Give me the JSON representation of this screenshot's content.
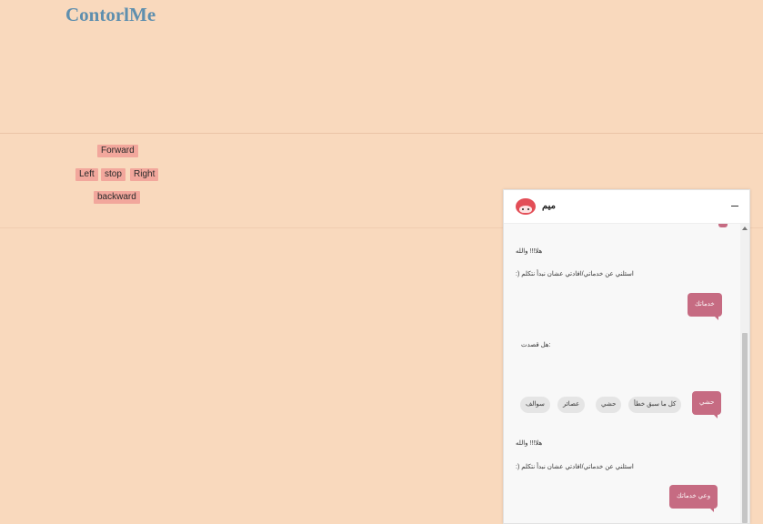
{
  "app": {
    "title": "ContorlMe"
  },
  "controls": {
    "forward": "Forward",
    "left": "Left",
    "stop": "stop",
    "right": "Right",
    "backward": "backward"
  },
  "chat": {
    "bot_name": "ميم",
    "messages": {
      "greeting_1": "هلا!!! والله",
      "intro_1": ":) اسئلني عن خدماتي/افادتي عشان نبدأ نتكلم",
      "user_1": "خدماتك",
      "question": "هل قصدت:",
      "user_2": "حشي",
      "greeting_2": "هلا!!! والله",
      "intro_2": ":) اسئلني عن خدماتي/افادتي عشان نبدأ نتكلم",
      "user_3": "وعي خدماتك"
    },
    "quick_replies": [
      "كل ما سبق خطأ",
      "حشي",
      "عصائر",
      "سوالف"
    ]
  },
  "colors": {
    "page_bg": "#f9d9bd",
    "title": "#5f8fae",
    "control_button": "#f2a79c",
    "user_bubble": "#c66b82",
    "avatar": "#e34e57"
  }
}
